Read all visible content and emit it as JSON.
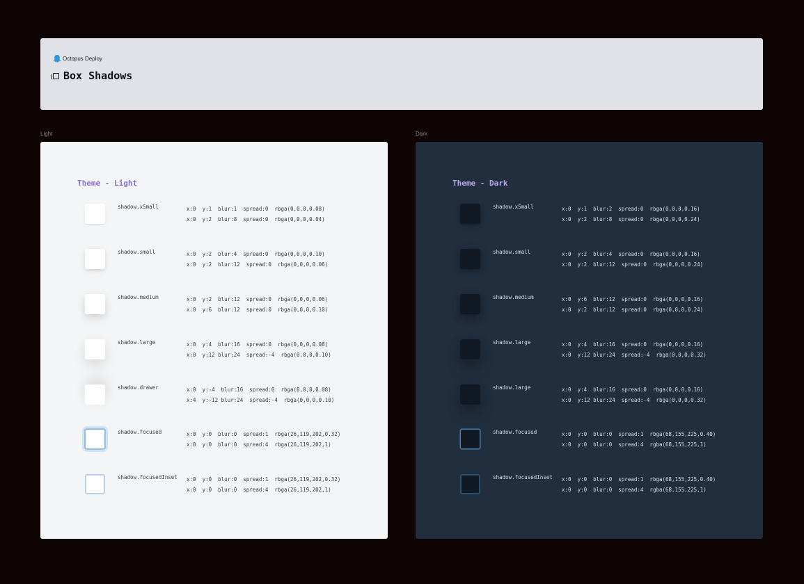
{
  "header": {
    "brand": "Octopus Deploy",
    "brand_icon": "octopus-logo-icon",
    "title": "Box Shadows",
    "title_icon": "box-icon"
  },
  "colors": {
    "page_background": "#0f0404",
    "header_background": "#e1e2e7",
    "light_panel": "#f4f5f7",
    "dark_panel": "#212e3e",
    "light_theme_title": "#8a6fcf",
    "dark_theme_title": "#b9a8ef"
  },
  "sections": {
    "light_label": "Light",
    "dark_label": "Dark"
  },
  "light": {
    "title": "Theme - Light",
    "rows": [
      {
        "token": "shadow.xSmall",
        "line1": "x:0  y:1  blur:1  spread:0  rbga(0,0,0,0.08)",
        "line2": "x:0  y:2  blur:8  spread:0  rbga(0,0,0,0.04)"
      },
      {
        "token": "shadow.small",
        "line1": "x:0  y:2  blur:4  spread:0  rbga(0,0,0,0.10)",
        "line2": "x:0  y:2  blur:12  spread:0  rbga(0,0,0,0.06)"
      },
      {
        "token": "shadow.medium",
        "line1": "x:0  y:2  blur:12  spread:0  rbga(0,0,0,0.06)",
        "line2": "x:0  y:6  blur:12  spread:0  rbga(0,0,0,0.10)"
      },
      {
        "token": "shadow.large",
        "line1": "x:0  y:4  blur:16  spread:0  rbga(0,0,0,0.08)",
        "line2": "x:0  y:12 blur:24  spread:-4  rbga(0,0,0,0.10)"
      },
      {
        "token": "shadow.drawer",
        "line1": "x:0  y:-4  blur:16  spread:0  rbga(0,0,0,0.08)",
        "line2": "x:4  y:-12 blur:24  spread:-4  rbga(0,0,0,0.10)"
      },
      {
        "token": "shadow.focused",
        "line1": "x:0  y:0  blur:0  spread:1  rbga(26,119,202,0.32)",
        "line2": "x:0  y:0  blur:0  spread:4  rbga(26,119,202,1)"
      },
      {
        "token": "shadow.focusedInset",
        "line1": "x:0  y:0  blur:0  spread:1  rbga(26,119,202,0.32)",
        "line2": "x:0  y:0  blur:0  spread:4  rbga(26,119,202,1)"
      }
    ]
  },
  "dark": {
    "title": "Theme - Dark",
    "rows": [
      {
        "token": "shadow.xSmall",
        "line1": "x:0  y:1  blur:2  spread:0  rbga(0,0,0,0.16)",
        "line2": "x:0  y:2  blur:8  spread:0  rbga(0,0,0,0.24)"
      },
      {
        "token": "shadow.small",
        "line1": "x:0  y:2  blur:4  spread:0  rbga(0,0,0,0.16)",
        "line2": "x:0  y:2  blur:12  spread:0  rbga(0,0,0,0.24)"
      },
      {
        "token": "shadow.medium",
        "line1": "x:0  y:6  blur:12  spread:0  rbga(0,0,0,0.16)",
        "line2": "x:0  y:2  blur:12  spread:0  rbga(0,0,0,0.24)"
      },
      {
        "token": "shadow.large",
        "line1": "x:0  y:4  blur:16  spread:0  rbga(0,0,0,0.16)",
        "line2": "x:0  y:12 blur:24  spread:-4  rbga(0,0,0,0.32)"
      },
      {
        "token": "shadow.large",
        "line1": "x:0  y:4  blur:16  spread:0  rbga(0,0,0,0.16)",
        "line2": "x:0  y:12 blur:24  spread:-4  rbga(0,0,0,0.32)"
      },
      {
        "token": "shadow.focused",
        "line1": "x:0  y:0  blur:0  spread:1  rbga(68,155,225,0.40)",
        "line2": "x:0  y:0  blur:0  spread:4  rgba(68,155,225,1)"
      },
      {
        "token": "shadow.focusedInset",
        "line1": "x:0  y:0  blur:0  spread:1  rbga(68,155,225,0.40)",
        "line2": "x:0  y:0  blur:0  spread:4  rgba(68,155,225,1)"
      }
    ]
  }
}
